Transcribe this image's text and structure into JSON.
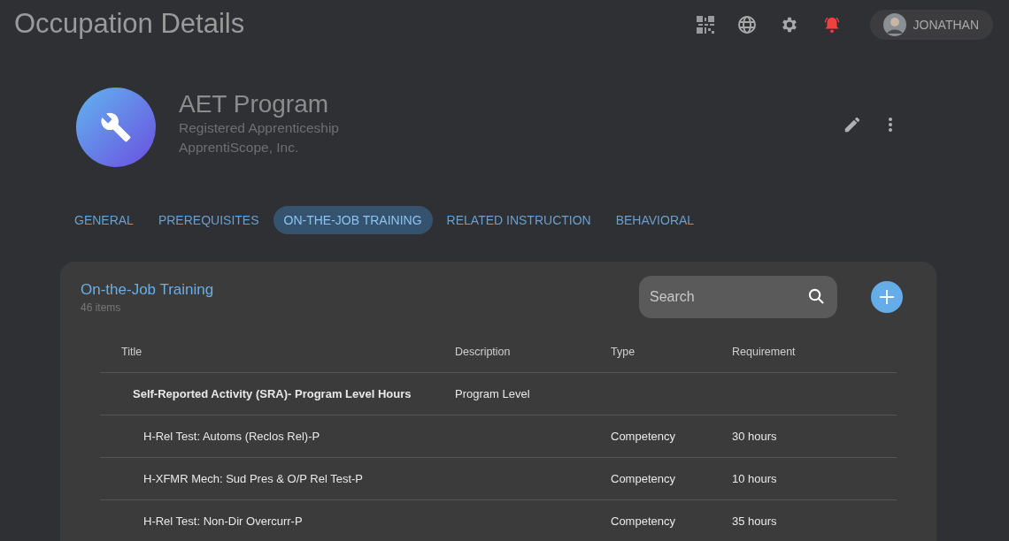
{
  "page_title": "Occupation Details",
  "user": {
    "name": "JONATHAN"
  },
  "program": {
    "title": "AET Program",
    "subtitle": "Registered Apprenticeship",
    "organization": "ApprentiScope, Inc."
  },
  "tabs": [
    {
      "label": "GENERAL",
      "selected": false
    },
    {
      "label": "PREREQUISITES",
      "selected": false
    },
    {
      "label": "ON-THE-JOB TRAINING",
      "selected": true
    },
    {
      "label": "RELATED INSTRUCTION",
      "selected": false
    },
    {
      "label": "BEHAVIORAL",
      "selected": false
    }
  ],
  "panel": {
    "title": "On-the-Job Training",
    "count": "46 items",
    "search": {
      "placeholder": "Search"
    }
  },
  "table": {
    "columns": [
      "Title",
      "Description",
      "Type",
      "Requirement"
    ],
    "rows": [
      {
        "kind": "group",
        "cells": [
          "Self-Reported Activity (SRA)- Program Level Hours",
          "Program Level",
          "",
          ""
        ]
      },
      {
        "kind": "item",
        "cells": [
          "H-Rel Test: Automs (Reclos Rel)-P",
          "",
          "Competency",
          "30 hours"
        ]
      },
      {
        "kind": "item",
        "cells": [
          "H-XFMR Mech: Sud Pres & O/P Rel Test-P",
          "",
          "Competency",
          "10 hours"
        ]
      },
      {
        "kind": "item",
        "cells": [
          "H-Rel Test: Non-Dir Overcurr-P",
          "",
          "Competency",
          "35 hours"
        ]
      }
    ]
  }
}
